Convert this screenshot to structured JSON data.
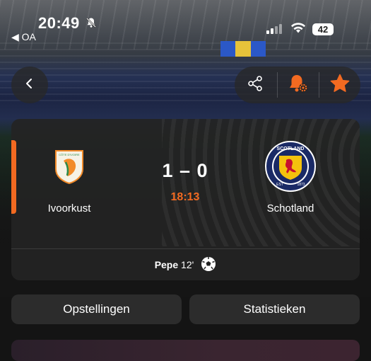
{
  "status_bar": {
    "time": "20:49",
    "back_app": "◀ OA",
    "battery": "42"
  },
  "match": {
    "home_team": "Ivoorkust",
    "away_team": "Schotland",
    "score": "1 – 0",
    "clock": "18:13",
    "scorer_name": "Pepe",
    "scorer_minute": "12'"
  },
  "crest_text": {
    "home": "CÔTE D'IVOIRE",
    "away_top": "SCOTLAND",
    "away_left": "EST",
    "away_right": "1873"
  },
  "tabs": {
    "lineups": "Opstellingen",
    "stats": "Statistieken"
  },
  "icons": {
    "back": "chevron-left-icon",
    "share": "share-icon",
    "notify": "bell-gear-icon",
    "favorite": "star-icon",
    "ball": "soccer-ball-icon"
  },
  "colors": {
    "accent": "#f26a21",
    "card": "#242424"
  }
}
